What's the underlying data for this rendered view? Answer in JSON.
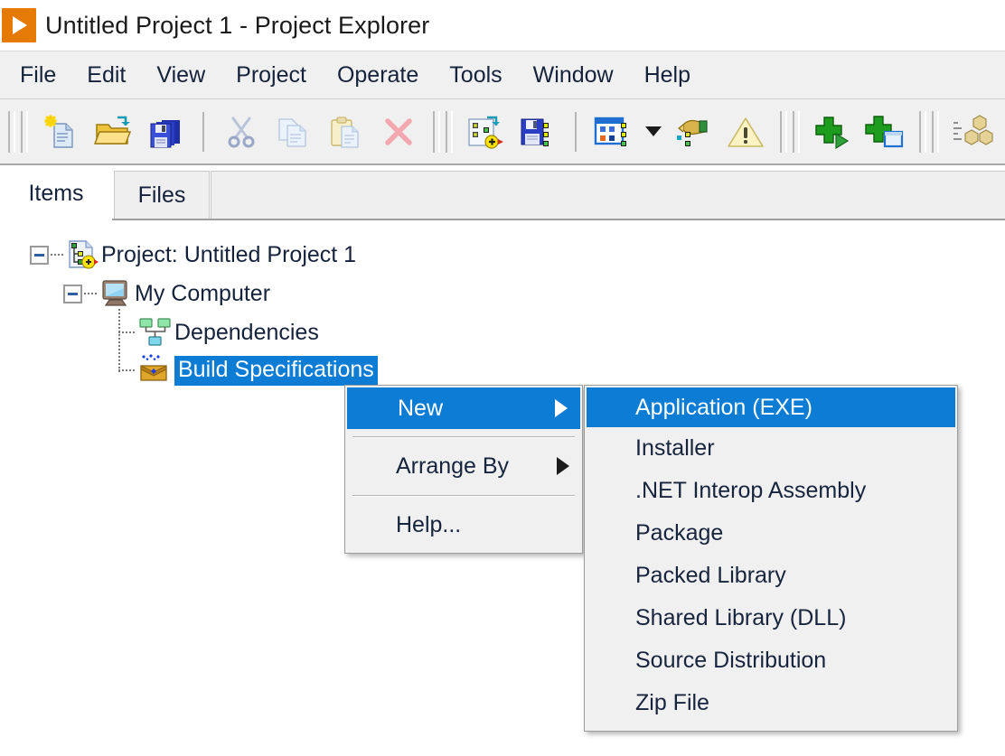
{
  "window": {
    "title": "Untitled Project 1 - Project Explorer",
    "app_icon": "labview-run-icon",
    "accent_blue": "#0c7cd5",
    "brand_orange": "#E57B06",
    "chrome_gray": "#f0f0f0"
  },
  "menubar": {
    "items": [
      {
        "label": "File"
      },
      {
        "label": "Edit"
      },
      {
        "label": "View"
      },
      {
        "label": "Project"
      },
      {
        "label": "Operate"
      },
      {
        "label": "Tools"
      },
      {
        "label": "Window"
      },
      {
        "label": "Help"
      }
    ]
  },
  "toolbar": {
    "groups": [
      {
        "buttons": [
          {
            "icon": "new-file-icon",
            "enabled": true
          },
          {
            "icon": "open-folder-icon",
            "enabled": true
          },
          {
            "icon": "save-all-icon",
            "enabled": true
          }
        ]
      },
      {
        "buttons": [
          {
            "icon": "cut-scissors-icon",
            "enabled": false
          },
          {
            "icon": "copy-icon",
            "enabled": false
          },
          {
            "icon": "paste-icon",
            "enabled": false
          },
          {
            "icon": "delete-x-icon",
            "enabled": false
          }
        ]
      },
      {
        "buttons": [
          {
            "icon": "new-vi-icon",
            "enabled": true
          },
          {
            "icon": "save-project-icon",
            "enabled": true
          }
        ]
      },
      {
        "buttons": [
          {
            "icon": "project-view-icon",
            "enabled": true
          },
          {
            "icon": "dropdown-caret-icon",
            "enabled": true
          },
          {
            "icon": "build-hand-icon",
            "enabled": true
          },
          {
            "icon": "warning-triangle-icon",
            "enabled": true
          }
        ]
      },
      {
        "buttons": [
          {
            "icon": "add-run-icon",
            "enabled": true
          },
          {
            "icon": "add-window-icon",
            "enabled": true
          }
        ]
      },
      {
        "buttons": [
          {
            "icon": "list-blocks-icon",
            "enabled": true
          },
          {
            "icon": "list-block-single-icon",
            "enabled": true
          }
        ]
      }
    ]
  },
  "tabs": {
    "items": [
      {
        "label": "Items",
        "active": true
      },
      {
        "label": "Files",
        "active": false
      }
    ]
  },
  "tree": {
    "nodes": [
      {
        "label": "Project: Untitled Project 1",
        "icon": "project-icon",
        "expanded": true,
        "selected": false,
        "depth": 0
      },
      {
        "label": "My Computer",
        "icon": "my-computer-icon",
        "expanded": true,
        "selected": false,
        "depth": 1
      },
      {
        "label": "Dependencies",
        "icon": "dependencies-icon",
        "expanded": false,
        "selected": false,
        "depth": 2
      },
      {
        "label": "Build Specifications",
        "icon": "build-specifications-icon",
        "expanded": false,
        "selected": true,
        "depth": 2
      }
    ]
  },
  "context_menu": {
    "items": [
      {
        "label": "New",
        "submenu": true,
        "highlighted": true,
        "separator_after": true
      },
      {
        "label": "Arrange By",
        "submenu": true,
        "highlighted": false,
        "separator_after": true
      },
      {
        "label": "Help...",
        "submenu": false,
        "highlighted": false,
        "separator_after": false
      }
    ]
  },
  "submenu": {
    "title": "New",
    "items": [
      {
        "label": "Application (EXE)",
        "highlighted": true
      },
      {
        "label": "Installer",
        "highlighted": false
      },
      {
        "label": ".NET Interop Assembly",
        "highlighted": false
      },
      {
        "label": "Package",
        "highlighted": false
      },
      {
        "label": "Packed Library",
        "highlighted": false
      },
      {
        "label": "Shared Library (DLL)",
        "highlighted": false
      },
      {
        "label": "Source Distribution",
        "highlighted": false
      },
      {
        "label": "Zip File",
        "highlighted": false
      }
    ]
  }
}
